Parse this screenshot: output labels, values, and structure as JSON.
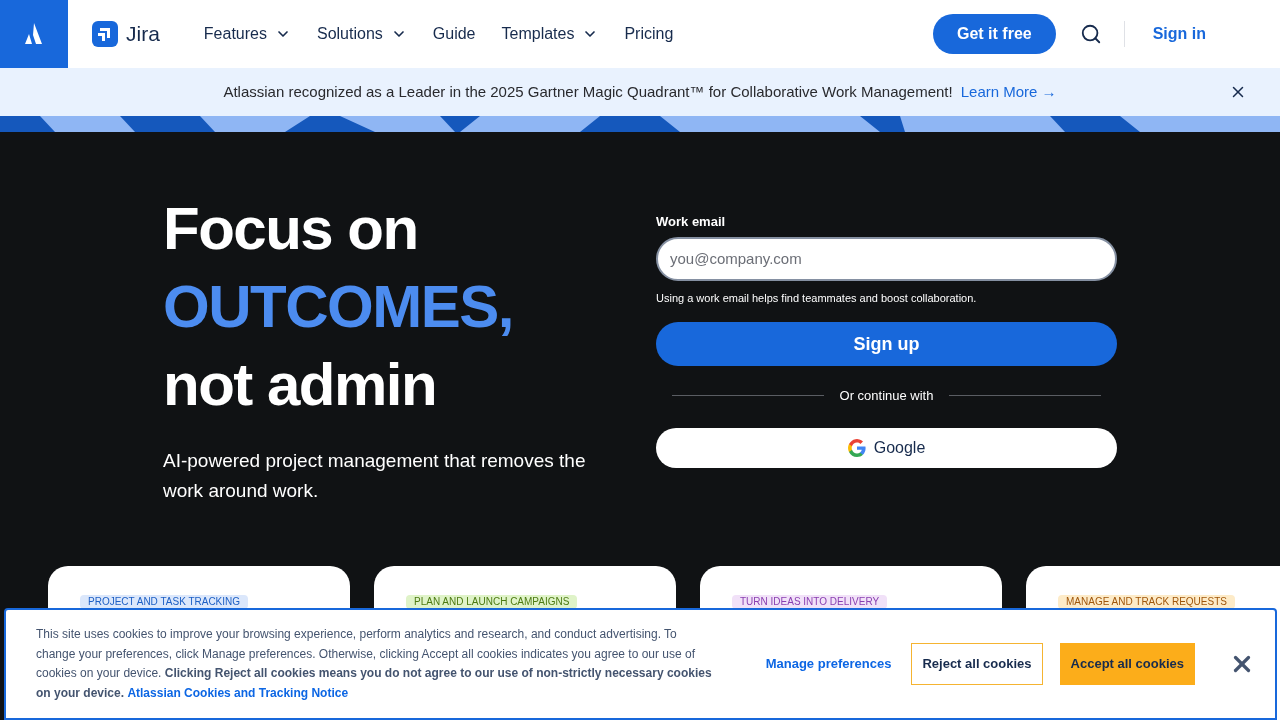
{
  "header": {
    "product": "Jira",
    "nav": [
      {
        "label": "Features",
        "dropdown": true
      },
      {
        "label": "Solutions",
        "dropdown": true
      },
      {
        "label": "Guide",
        "dropdown": false
      },
      {
        "label": "Templates",
        "dropdown": true
      },
      {
        "label": "Pricing",
        "dropdown": false
      }
    ],
    "cta": "Get it free",
    "sign_in": "Sign in"
  },
  "announcement": {
    "text": "Atlassian recognized as a Leader in the 2025 Gartner Magic Quadrant™ for Collaborative Work Management!",
    "link": "Learn More →"
  },
  "hero": {
    "headline": [
      "Focus on",
      "OUTCOMES,",
      "not admin"
    ],
    "subtitle": "AI-powered project management that removes the work around work."
  },
  "signup": {
    "label": "Work email",
    "placeholder": "you@company.com",
    "hint": "Using a work email helps find teammates and boost collaboration.",
    "button": "Sign up",
    "divider": "Or continue with",
    "google": "Google"
  },
  "cards": [
    {
      "tag": "PROJECT AND TASK TRACKING",
      "color": "#1d5fc4"
    },
    {
      "tag": "PLAN AND LAUNCH CAMPAIGNS",
      "color": "#4c7a12"
    },
    {
      "tag": "TURN IDEAS INTO DELIVERY",
      "color": "#8a3fb0"
    },
    {
      "tag": "MANAGE AND TRACK REQUESTS",
      "color": "#a0560b"
    }
  ],
  "cookies": {
    "text": "This site uses cookies to improve your browsing experience, perform analytics and research, and conduct advertising. To change your preferences, click Manage preferences. Otherwise, clicking Accept all cookies indicates you agree to our use of cookies on your device. **Clicking Reject all cookies means you do not agree to our use of non-strictly necessary cookies on your device.**",
    "link": "Atlassian Cookies and Tracking Notice",
    "manage": "Manage preferences",
    "reject": "Reject all cookies",
    "accept": "Accept all cookies"
  }
}
